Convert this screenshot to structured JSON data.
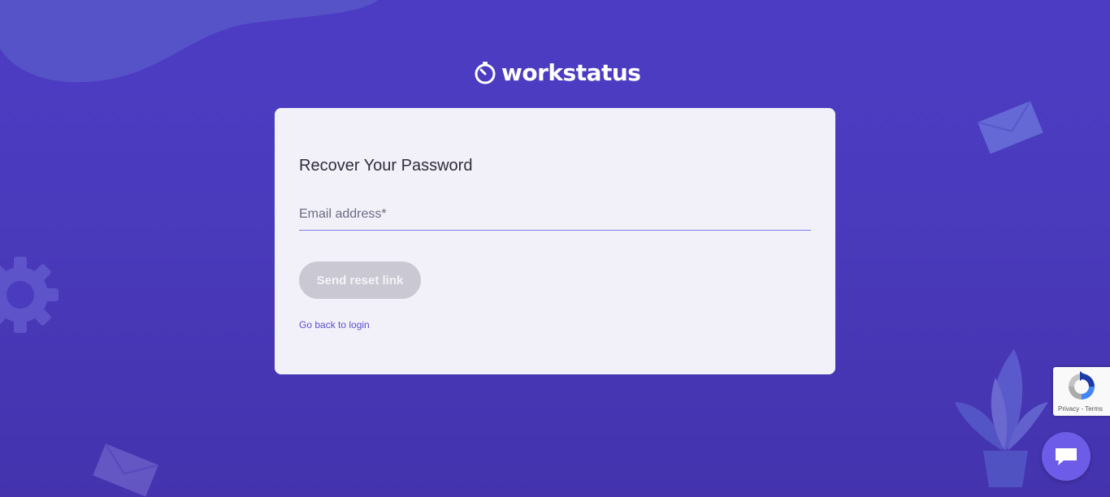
{
  "brand": {
    "logo_text": "workstatus",
    "logo_icon": "stopwatch-icon"
  },
  "recover_form": {
    "title": "Recover Your Password",
    "email_placeholder": "Email address*",
    "email_value": "",
    "submit_label": "Send reset link",
    "back_link_label": "Go back to login"
  },
  "recaptcha": {
    "privacy_label": "Privacy",
    "separator": "-",
    "terms_label": "Terms",
    "icon": "recaptcha-icon"
  },
  "chat": {
    "icon": "chat-bubble-icon"
  },
  "colors": {
    "background": "#4c3cc4",
    "card": "#f2f1fa",
    "accent": "#5a4fd1",
    "input_underline": "#7b7fe6",
    "button_disabled": "#c9c8d3",
    "chat_button": "#6c5ce7"
  }
}
